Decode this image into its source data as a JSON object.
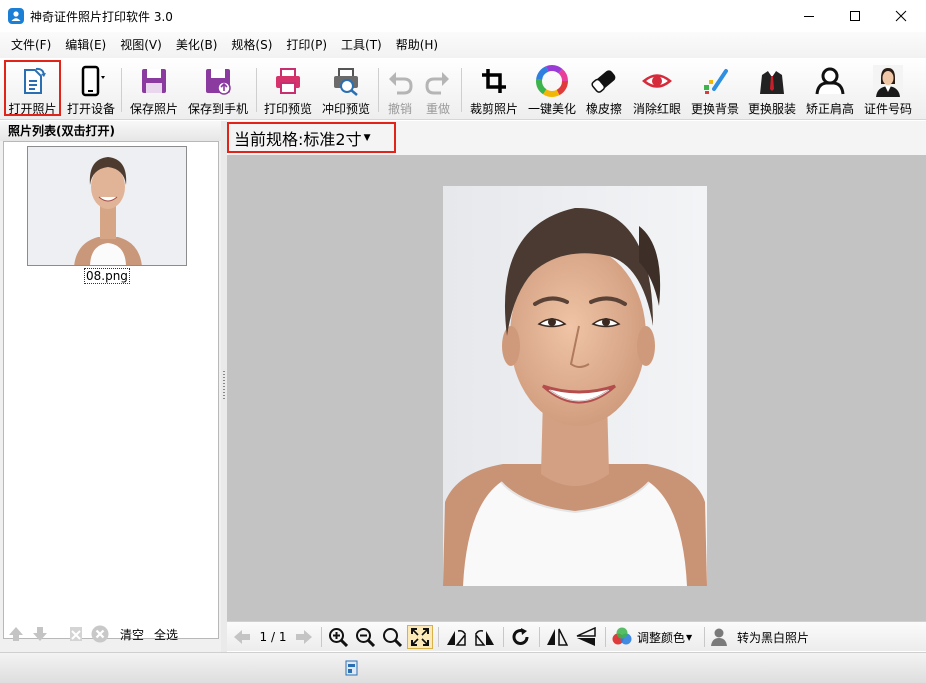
{
  "window": {
    "title": "神奇证件照片打印软件 3.0"
  },
  "menu": [
    "文件(F)",
    "编辑(E)",
    "视图(V)",
    "美化(B)",
    "规格(S)",
    "打印(P)",
    "工具(T)",
    "帮助(H)"
  ],
  "toolbar": {
    "open_photo": "打开照片",
    "open_device": "打开设备",
    "save_photo": "保存照片",
    "save_to_phone": "保存到手机",
    "print_preview": "打印预览",
    "develop_preview": "冲印预览",
    "undo": "撤销",
    "redo": "重做",
    "crop": "裁剪照片",
    "one_click_beautify": "一键美化",
    "eraser": "橡皮擦",
    "remove_red_eye": "消除红眼",
    "change_background": "更换背景",
    "change_clothes": "更换服装",
    "fix_shoulders": "矫正肩高",
    "id_number": "证件号码"
  },
  "photo_list": {
    "header": "照片列表(双击打开)",
    "items": [
      {
        "filename": "08.png"
      }
    ],
    "clear": "清空",
    "select_all": "全选"
  },
  "spec": {
    "label": "当前规格:",
    "value": "标准2寸"
  },
  "bottom": {
    "page": "1 / 1",
    "adjust_color": "调整颜色",
    "to_bw": "转为黑白照片"
  },
  "colors": {
    "highlight": "#e2231a",
    "canvas": "#c3c3c3"
  }
}
